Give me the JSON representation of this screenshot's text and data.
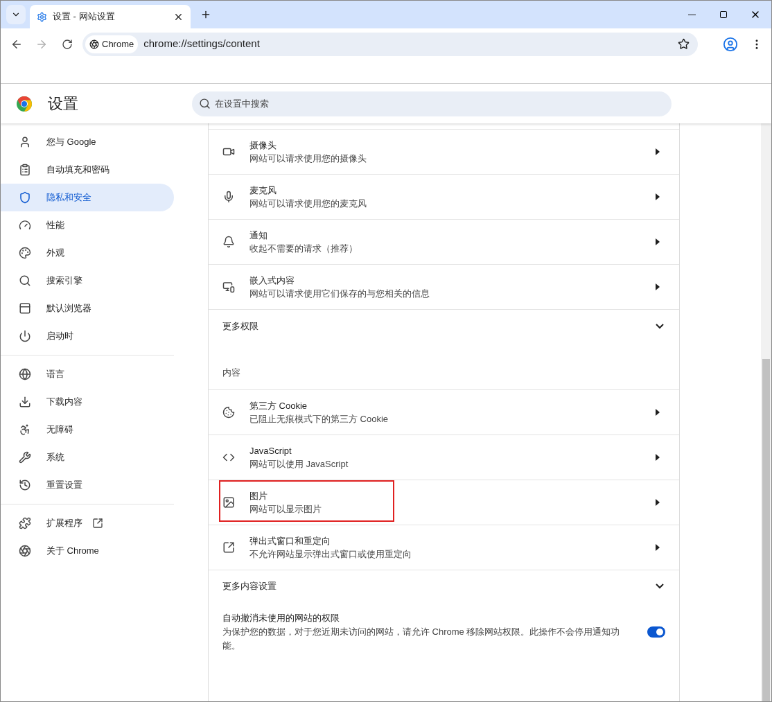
{
  "tab": {
    "title": "设置 - 网站设置"
  },
  "address_bar": {
    "chip": "Chrome",
    "url": "chrome://settings/content",
    "forward_disabled": true
  },
  "header": {
    "title": "设置",
    "search_placeholder": "在设置中搜索"
  },
  "sidebar": {
    "groups": [
      {
        "items": [
          {
            "label": "您与 Google",
            "selected": false
          },
          {
            "label": "自动填充和密码",
            "selected": false
          },
          {
            "label": "隐私和安全",
            "selected": true
          },
          {
            "label": "性能",
            "selected": false
          },
          {
            "label": "外观",
            "selected": false
          },
          {
            "label": "搜索引擎",
            "selected": false
          },
          {
            "label": "默认浏览器",
            "selected": false
          },
          {
            "label": "启动时",
            "selected": false
          }
        ]
      },
      {
        "items": [
          {
            "label": "语言",
            "selected": false
          },
          {
            "label": "下载内容",
            "selected": false
          },
          {
            "label": "无障碍",
            "selected": false
          },
          {
            "label": "系统",
            "selected": false
          },
          {
            "label": "重置设置",
            "selected": false
          }
        ]
      },
      {
        "items": [
          {
            "label": "扩展程序",
            "selected": false
          },
          {
            "label": "关于 Chrome",
            "selected": false
          }
        ]
      }
    ]
  },
  "permissions": [
    {
      "title": "摄像头",
      "subtitle": "网站可以请求使用您的摄像头"
    },
    {
      "title": "麦克风",
      "subtitle": "网站可以请求使用您的麦克风"
    },
    {
      "title": "通知",
      "subtitle": "收起不需要的请求（推荐）"
    },
    {
      "title": "嵌入式内容",
      "subtitle": "网站可以请求使用它们保存的与您相关的信息"
    }
  ],
  "more_permissions": {
    "label": "更多权限",
    "expanded": false
  },
  "content_heading": "内容",
  "content": [
    {
      "title": "第三方 Cookie",
      "subtitle": "已阻止无痕模式下的第三方 Cookie",
      "highlighted": false
    },
    {
      "title": "JavaScript",
      "subtitle": "网站可以使用 JavaScript",
      "highlighted": false
    },
    {
      "title": "图片",
      "subtitle": "网站可以显示图片",
      "highlighted": true
    },
    {
      "title": "弹出式窗口和重定向",
      "subtitle": "不允许网站显示弹出式窗口或使用重定向",
      "highlighted": false
    }
  ],
  "more_content": {
    "label": "更多内容设置",
    "expanded": false
  },
  "auto_revoke": {
    "title": "自动撤消未使用的网站的权限",
    "description": "为保护您的数据，对于您近期未访问的网站，请允许 Chrome 移除网站权限。此操作不会停用通知功能。",
    "on": true
  }
}
